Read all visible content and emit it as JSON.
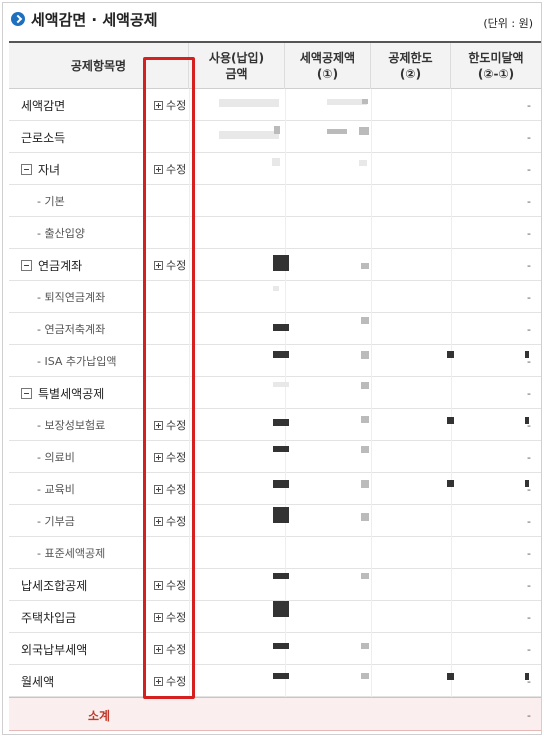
{
  "section": {
    "title": "세액감면 · 세액공제",
    "unit_note": "(단위 : 원)",
    "icon": "arrow-circle-icon"
  },
  "table": {
    "headers": [
      "공제항목명",
      "사용(납입)\n금액",
      "세액공제액\n(①)",
      "공제한도\n(②)",
      "한도미달액\n(②-①)"
    ],
    "edit_label": "수정",
    "rows": [
      {
        "name": "세액감면",
        "level": 0,
        "toggle": false,
        "edit": true
      },
      {
        "name": "근로소득",
        "level": 0,
        "toggle": false,
        "edit": false
      },
      {
        "name": "자녀",
        "level": 0,
        "toggle": true,
        "edit": true
      },
      {
        "name": "- 기본",
        "level": 1,
        "toggle": false,
        "edit": false
      },
      {
        "name": "- 출산입양",
        "level": 1,
        "toggle": false,
        "edit": false
      },
      {
        "name": "연금계좌",
        "level": 0,
        "toggle": true,
        "edit": true
      },
      {
        "name": "- 퇴직연금계좌",
        "level": 1,
        "toggle": false,
        "edit": false
      },
      {
        "name": "- 연금저축계좌",
        "level": 1,
        "toggle": false,
        "edit": false
      },
      {
        "name": "- ISA 추가납입액",
        "level": 1,
        "toggle": false,
        "edit": false
      },
      {
        "name": "특별세액공제",
        "level": 0,
        "toggle": true,
        "edit": false
      },
      {
        "name": "- 보장성보험료",
        "level": 1,
        "toggle": false,
        "edit": true
      },
      {
        "name": "- 의료비",
        "level": 1,
        "toggle": false,
        "edit": true
      },
      {
        "name": "- 교육비",
        "level": 1,
        "toggle": false,
        "edit": true
      },
      {
        "name": "- 기부금",
        "level": 1,
        "toggle": false,
        "edit": true
      },
      {
        "name": "- 표준세액공제",
        "level": 1,
        "toggle": false,
        "edit": false
      },
      {
        "name": "납세조합공제",
        "level": 0,
        "toggle": false,
        "edit": true
      },
      {
        "name": "주택차입금",
        "level": 0,
        "toggle": false,
        "edit": true
      },
      {
        "name": "외국납부세액",
        "level": 0,
        "toggle": false,
        "edit": true
      },
      {
        "name": "월세액",
        "level": 0,
        "toggle": false,
        "edit": true
      }
    ],
    "last_column_value": "-",
    "subtotal_label": "소계"
  },
  "colors": {
    "highlight_border": "#d62020",
    "subtotal_text": "#c0392b",
    "subtotal_bg": "#fbeeee",
    "title_icon": "#1f6fbf"
  }
}
